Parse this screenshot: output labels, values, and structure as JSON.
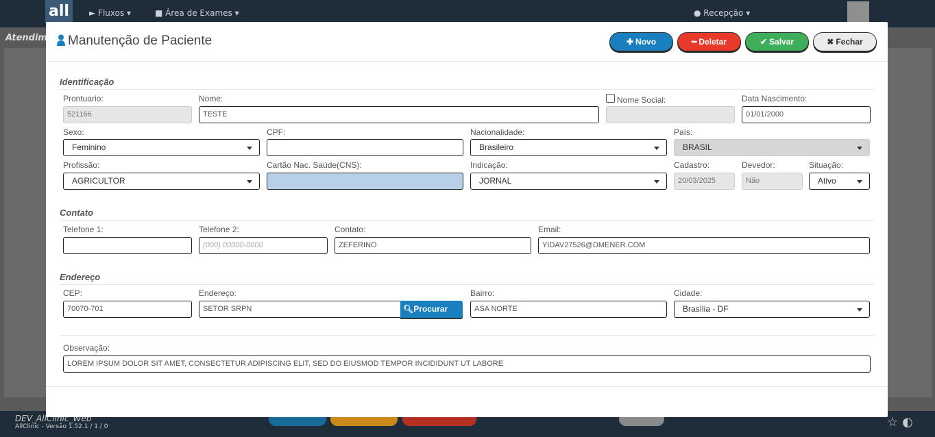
{
  "background": {
    "nav": [
      "Fluxos",
      "Área de Exames",
      "Recepção"
    ],
    "crumb": "Atendim",
    "logo": "all",
    "footer_env": "DEV_AllClinic_Web",
    "footer_version": "AllClinic - Versão 1.52.1 / 1 / 0"
  },
  "modal": {
    "title": "Manutenção de Paciente",
    "buttons": {
      "novo": "Novo",
      "deletar": "Deletar",
      "salvar": "Salvar",
      "fechar": "Fechar"
    }
  },
  "sections": {
    "identificacao": "Identificação",
    "contato": "Contato",
    "endereco": "Endereço"
  },
  "fields": {
    "prontuario": {
      "label": "Prontuario:",
      "value": "521166"
    },
    "nome": {
      "label": "Nome:",
      "value": "TESTE"
    },
    "nome_social": {
      "label": "Nome Social:",
      "value": "",
      "checked": false
    },
    "data_nascimento": {
      "label": "Data Nascimento:",
      "value": "01/01/2000"
    },
    "sexo": {
      "label": "Sexo:",
      "value": "Feminino"
    },
    "cpf": {
      "label": "CPF:",
      "value": ""
    },
    "nacionalidade": {
      "label": "Nacionalidade:",
      "value": "Brasileiro"
    },
    "pais": {
      "label": "País:",
      "value": "BRASIL"
    },
    "profissao": {
      "label": "Profissão:",
      "value": "AGRICULTOR"
    },
    "cns": {
      "label": "Cartão Nac. Saúde(CNS):",
      "value": ""
    },
    "indicacao": {
      "label": "Indicação:",
      "value": "JORNAL"
    },
    "cadastro": {
      "label": "Cadastro:",
      "value": "20/03/2025"
    },
    "devedor": {
      "label": "Devedor:",
      "value": "Não"
    },
    "situacao": {
      "label": "Situação:",
      "value": "Ativo"
    },
    "telefone1": {
      "label": "Telefone 1:",
      "value": ""
    },
    "telefone2": {
      "label": "Telefone 2:",
      "placeholder": "(000) 00000-0000"
    },
    "contato": {
      "label": "Contato:",
      "value": "ZEFERINO"
    },
    "email": {
      "label": "Email:",
      "value": "YIDAV27526@DMENER.COM"
    },
    "cep": {
      "label": "CEP:",
      "value": "70070-701"
    },
    "endereco": {
      "label": "Endereço:",
      "value": "SETOR SRPN"
    },
    "procurar_cep": "Procurar CEP",
    "bairro": {
      "label": "Bairro:",
      "value": "ASA NORTE"
    },
    "cidade": {
      "label": "Cidade:",
      "value": "Brasília - DF"
    },
    "observacao": {
      "label": "Observação:",
      "value": "LOREM IPSUM DOLOR SIT AMET, CONSECTETUR ADIPISCING ELIT, SED DO EIUSMOD TEMPOR INCIDIDUNT UT LABORE"
    }
  },
  "colors": {
    "primary": "#1a7fbf",
    "danger": "#e8392b",
    "success": "#3fae5a",
    "highlight_field": "#b8cfe8"
  }
}
